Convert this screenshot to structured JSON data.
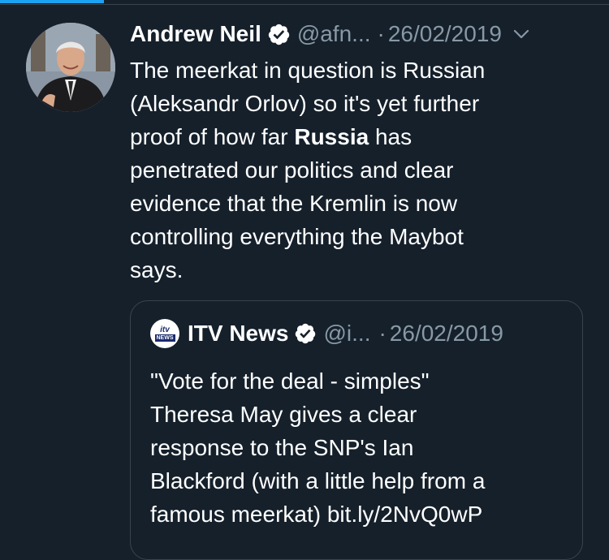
{
  "colors": {
    "background": "#15202b",
    "accent": "#1da1f2",
    "secondary_text": "#8899a6",
    "border": "#38444d",
    "primary_text": "#ffffff"
  },
  "tweet": {
    "author": {
      "display_name": "Andrew Neil",
      "handle": "@afn...",
      "verified_icon": "verified-badge-icon",
      "avatar": "profile-photo"
    },
    "separator": "·",
    "timestamp": "26/02/2019",
    "menu_icon": "chevron-down-icon",
    "text": {
      "lines_1": "The meerkat in question is Russian",
      "lines_2": "(Aleksandr Orlov) so it's yet further",
      "lines_3_before": "proof of how far ",
      "lines_3_bold": "Russia",
      "lines_3_after": " has",
      "lines_4": "penetrated our politics and clear",
      "lines_5": "evidence that the Kremlin is now",
      "lines_6": "controlling everything the Maybot",
      "lines_7": "says."
    }
  },
  "quoted_tweet": {
    "author": {
      "logo_top": "itv",
      "logo_bottom": "NEWS",
      "display_name": "ITV News",
      "handle": "@i...",
      "verified_icon": "verified-badge-icon"
    },
    "separator": "·",
    "timestamp": "26/02/2019",
    "text": {
      "line_1": "\"Vote for the deal - simples\"",
      "line_2": "Theresa May gives a clear",
      "line_3": "response to the SNP's Ian",
      "line_4": "Blackford (with a little help from a",
      "line_5": "famous meerkat) bit.ly/2NvQ0wP"
    }
  }
}
